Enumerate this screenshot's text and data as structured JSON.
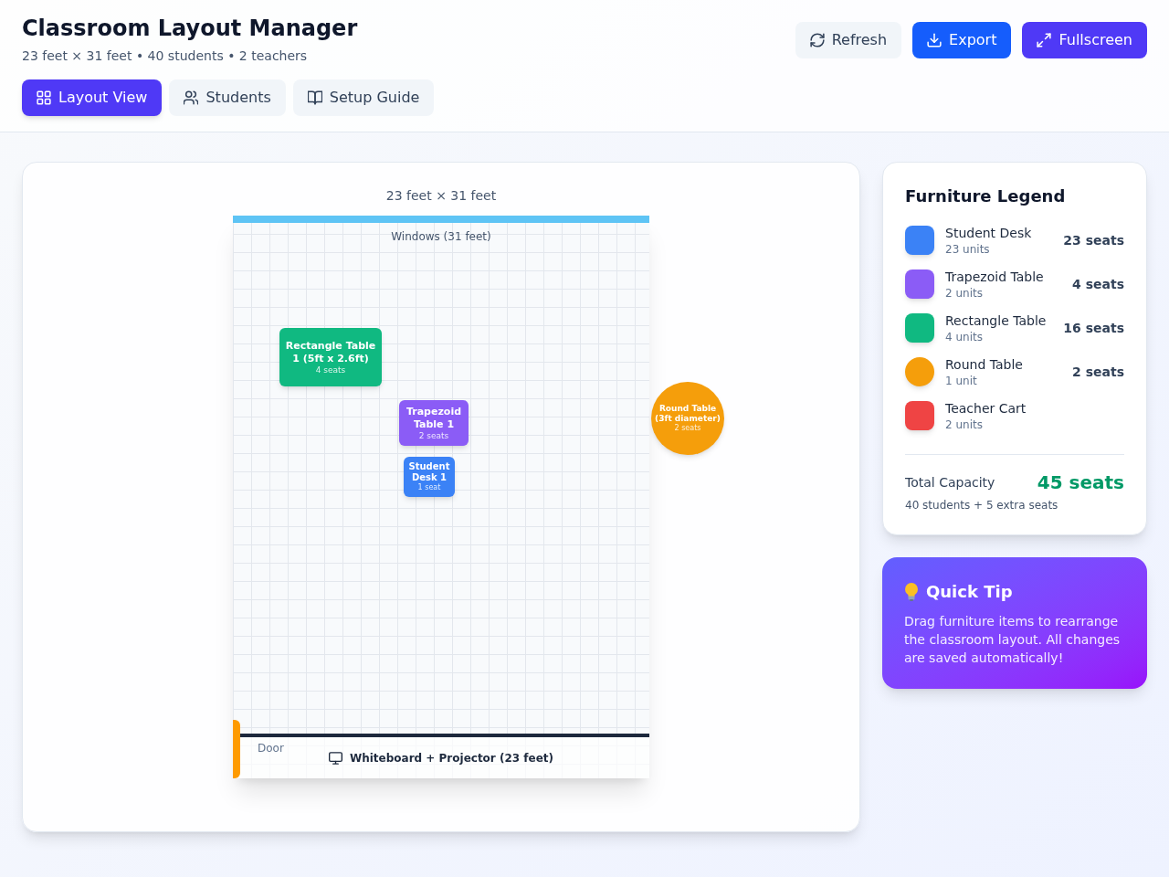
{
  "header": {
    "title": "Classroom Layout Manager",
    "subtitle": "23 feet × 31 feet • 40 students • 2 teachers"
  },
  "tabs": [
    {
      "label": "Layout View",
      "selected": true
    },
    {
      "label": "Students",
      "selected": false
    },
    {
      "label": "Setup Guide",
      "selected": false
    }
  ],
  "actions": [
    {
      "label": "Refresh",
      "kind": "secondary"
    },
    {
      "label": "Export",
      "kind": "primary"
    },
    {
      "label": "Fullscreen",
      "kind": "accent"
    }
  ],
  "room": {
    "dimensions": "23 feet × 31 feet",
    "windows_label": "Windows (31 feet)",
    "furniture": [
      {
        "kind": "rectangle",
        "label": "Rectangle Table 1 (5ft x 2.6ft)",
        "seats": "4 seats",
        "color": "#10b981"
      },
      {
        "kind": "trapezoid",
        "label": "Trapezoid Table 1",
        "seats": "2 seats",
        "color": "#8b5cf6"
      },
      {
        "kind": "round",
        "label": "Round Table (3ft diameter)",
        "seats": "2 seats",
        "color": "#f59e0b"
      },
      {
        "kind": "desk",
        "label": "Student Desk 1",
        "seats": "1 seat",
        "color": "#3b82f6"
      }
    ],
    "door_label": "Door",
    "whiteboard_label": "Whiteboard + Projector (23 feet)"
  },
  "legend": {
    "title": "Furniture Legend",
    "items": [
      {
        "kind": "square",
        "name": "Student Desk",
        "units": "23 units",
        "seats": "23 seats",
        "color": "#3b82f6"
      },
      {
        "kind": "square",
        "name": "Trapezoid Table",
        "units": "2 units",
        "seats": "4 seats",
        "color": "#8b5cf6"
      },
      {
        "kind": "square",
        "name": "Rectangle Table",
        "units": "4 units",
        "seats": "16 seats",
        "color": "#10b981"
      },
      {
        "kind": "round",
        "name": "Round Table",
        "units": "1 unit",
        "seats": "2 seats",
        "color": "#f59e0b"
      },
      {
        "kind": "square",
        "name": "Teacher Cart",
        "units": "2 units",
        "color": "#ef4444"
      }
    ],
    "total_label": "Total Capacity",
    "total_value": "45 seats",
    "total_note": "40 students + 5 extra seats"
  },
  "tip": {
    "title": "Quick Tip",
    "text": "Drag furniture items to rearrange the classroom layout. All changes are saved automatically!"
  }
}
